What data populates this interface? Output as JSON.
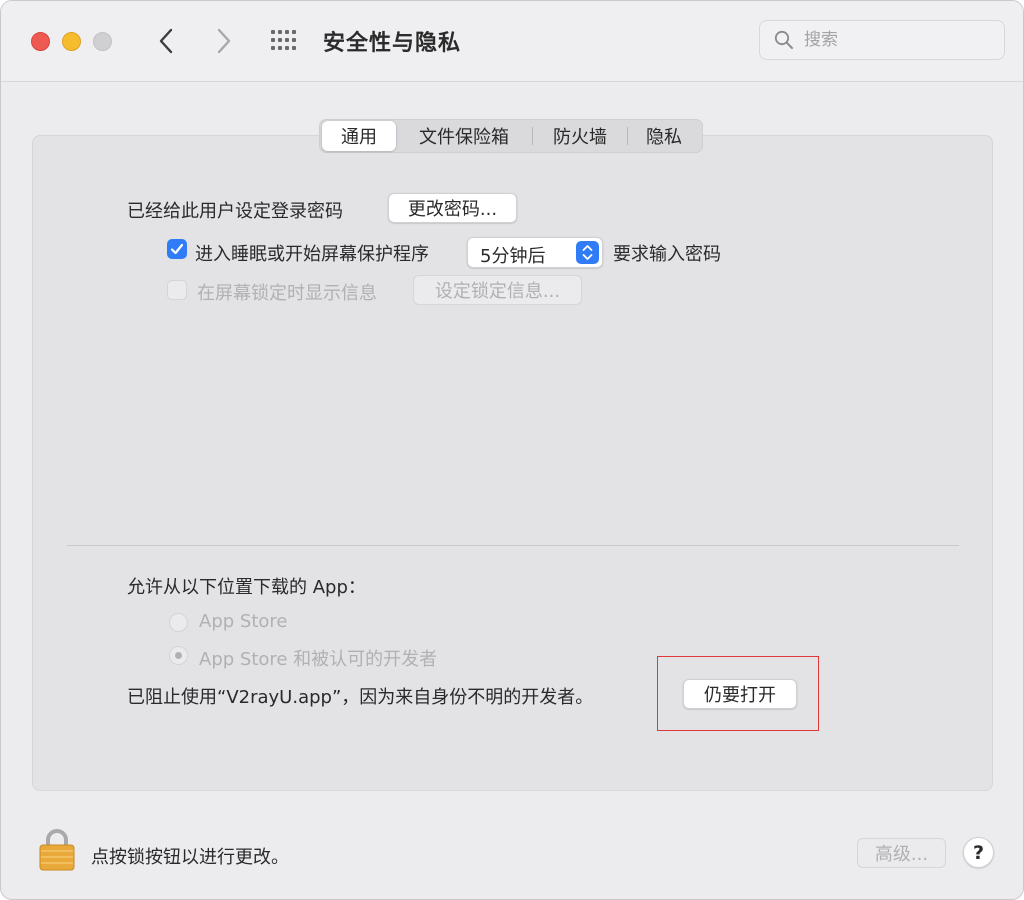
{
  "window": {
    "title": "安全性与隐私"
  },
  "search": {
    "placeholder": "搜索"
  },
  "tabs": [
    {
      "label": "通用",
      "active": true
    },
    {
      "label": "文件保险箱",
      "active": false
    },
    {
      "label": "防火墙",
      "active": false
    },
    {
      "label": "隐私",
      "active": false
    }
  ],
  "general": {
    "password_set_label": "已经给此用户设定登录密码",
    "change_password_button": "更改密码...",
    "require_password": {
      "checked": true,
      "label": "进入睡眠或开始屏幕保护程序",
      "delay_value": "5分钟后",
      "suffix": "要求输入密码"
    },
    "lock_message": {
      "checked": false,
      "enabled": false,
      "label": "在屏幕锁定时显示信息",
      "button": "设定锁定信息..."
    }
  },
  "downloads": {
    "heading": "允许从以下位置下载的 App：",
    "options": [
      {
        "label": "App Store",
        "selected": false,
        "enabled": false
      },
      {
        "label": "App Store 和被认可的开发者",
        "selected": true,
        "enabled": false
      }
    ],
    "blocked_message": "已阻止使用“V2rayU.app”，因为来自身份不明的开发者。",
    "open_anyway_button": "仍要打开"
  },
  "footer": {
    "lock_text": "点按锁按钮以进行更改。",
    "advanced_button": "高级...",
    "help_button": "?"
  },
  "colors": {
    "accent": "#2f7cf6",
    "highlight_box": "#e0383b",
    "traffic_red": "#ee5a52",
    "traffic_yellow": "#f5bd2e",
    "traffic_inactive": "#d0cfd2"
  }
}
